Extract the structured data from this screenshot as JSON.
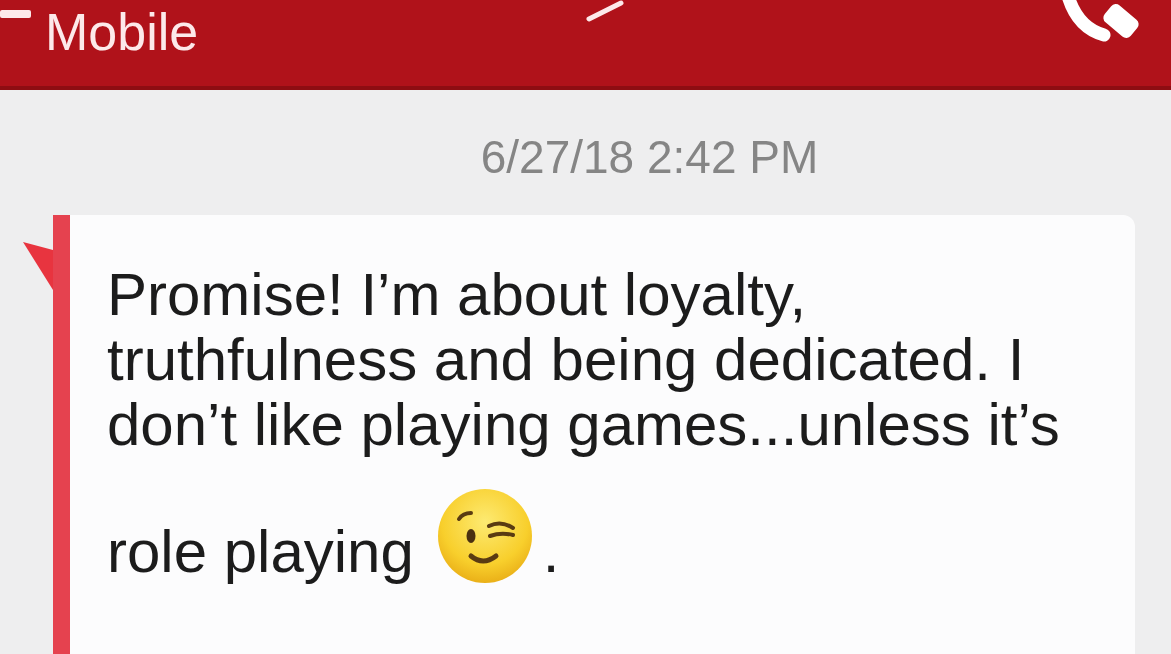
{
  "header": {
    "title": "Mobile"
  },
  "timestamp": "6/27/18 2:42 PM",
  "message": {
    "text": "Promise! I’m about loyalty, truthfulness and being dedicated. I don’t like playing games...unless it’s",
    "last_line": "role playing",
    "trailing_text": "."
  }
}
